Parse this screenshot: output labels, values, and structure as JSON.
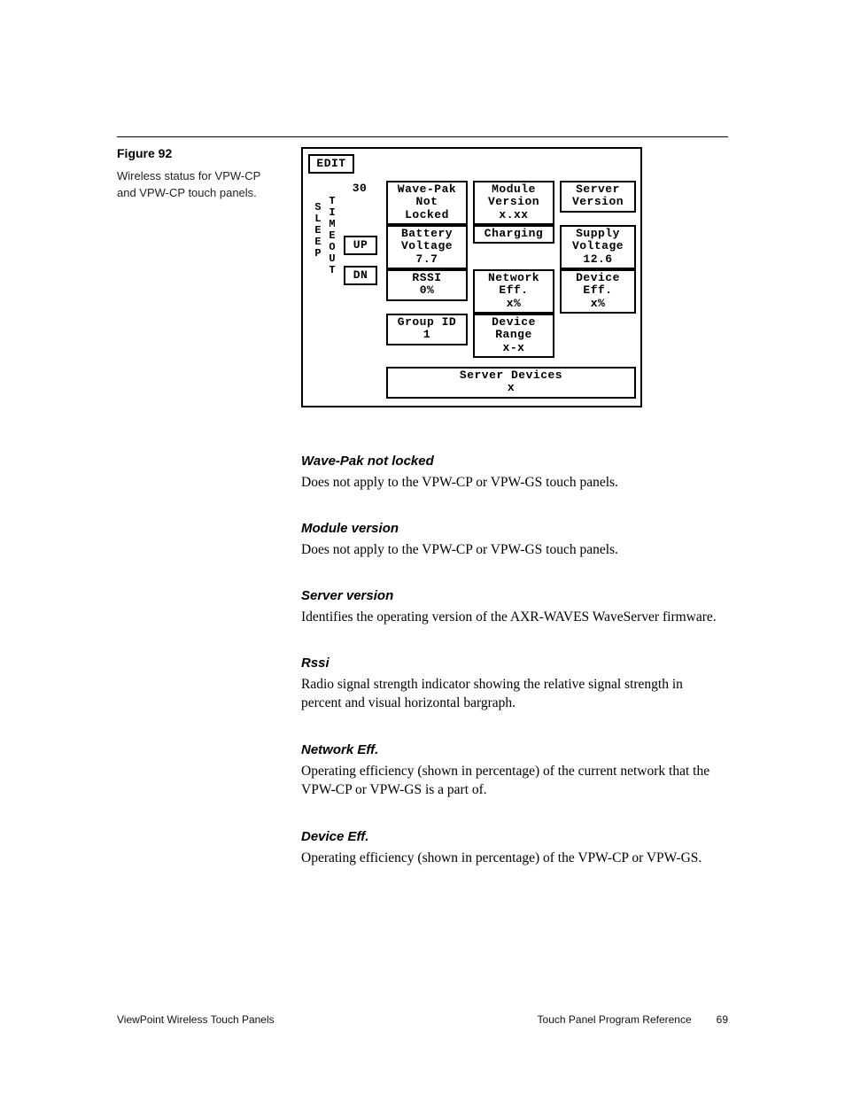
{
  "figure": {
    "label": "Figure 92",
    "caption": "Wireless status for VPW-CP and VPW-CP touch panels."
  },
  "panel": {
    "edit": "EDIT",
    "sleep": "SLEEP",
    "timeout": "TIMEOUT",
    "timeout_value": "30",
    "up": "UP",
    "dn": "DN",
    "wavepak": "Wave-Pak\nNot\nLocked",
    "module_version": "Module\nVersion\nx.xx",
    "server_version": "Server\nVersion",
    "battery_voltage": "Battery\nVoltage\n7.7",
    "charging": "Charging",
    "supply_voltage": "Supply\nVoltage\n12.6",
    "rssi": "RSSI\n0%",
    "network_eff": "Network\nEff.\nx%",
    "device_eff": "Device\nEff.\nx%",
    "group_id": "Group ID\n1",
    "device_range": "Device\nRange\nx-x",
    "server_devices": "Server Devices\nx"
  },
  "sections": {
    "wavepak": {
      "heading": "Wave-Pak not locked",
      "body": "Does not apply to the VPW-CP or VPW-GS touch panels."
    },
    "module_version": {
      "heading": "Module version",
      "body": "Does not apply to the VPW-CP or VPW-GS touch panels."
    },
    "server_version": {
      "heading": "Server version",
      "body": "Identifies the operating version of the AXR-WAVES WaveServer firmware."
    },
    "rssi": {
      "heading": "Rssi",
      "body": "Radio signal strength indicator showing the relative signal strength in percent and visual horizontal bargraph."
    },
    "network_eff": {
      "heading": "Network Eff.",
      "body": "Operating efficiency (shown in percentage) of the current network that the VPW-CP or VPW-GS is a part of."
    },
    "device_eff": {
      "heading": "Device Eff.",
      "body": "Operating efficiency (shown in percentage) of the VPW-CP or VPW-GS."
    }
  },
  "footer": {
    "left": "ViewPoint Wireless Touch Panels",
    "right": "Touch Panel Program Reference",
    "page": "69"
  }
}
